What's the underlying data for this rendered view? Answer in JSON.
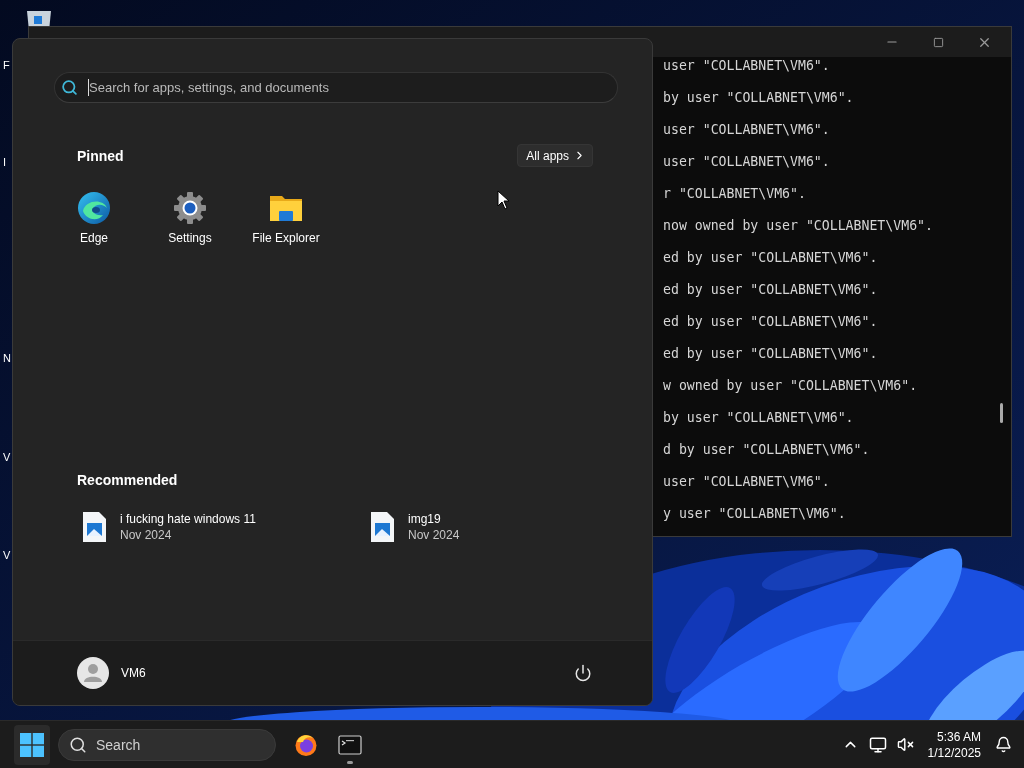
{
  "desktop": {
    "icon_labels": [
      "F",
      "I",
      "N",
      "V",
      "V"
    ]
  },
  "terminal": {
    "lines": [
      "user \"COLLABNET\\VM6\".",
      "by user \"COLLABNET\\VM6\".",
      "user \"COLLABNET\\VM6\".",
      "user \"COLLABNET\\VM6\".",
      "r \"COLLABNET\\VM6\".",
      "now owned by user \"COLLABNET\\VM6\".",
      "ed by user \"COLLABNET\\VM6\".",
      "ed by user \"COLLABNET\\VM6\".",
      "ed by user \"COLLABNET\\VM6\".",
      "ed by user \"COLLABNET\\VM6\".",
      "w owned by user \"COLLABNET\\VM6\".",
      "by user \"COLLABNET\\VM6\".",
      "d by user \"COLLABNET\\VM6\".",
      "user \"COLLABNET\\VM6\".",
      "y user \"COLLABNET\\VM6\"."
    ]
  },
  "start_menu": {
    "search": {
      "placeholder": "Search for apps, settings, and documents"
    },
    "pinned": {
      "title": "Pinned",
      "all_apps": "All apps",
      "apps": [
        {
          "label": "Edge",
          "kind": "edge"
        },
        {
          "label": "Settings",
          "kind": "settings"
        },
        {
          "label": "File Explorer",
          "kind": "folder"
        }
      ]
    },
    "recommended": {
      "title": "Recommended",
      "items": [
        {
          "name": "i fucking hate windows 11",
          "date": "Nov 2024"
        },
        {
          "name": "img19",
          "date": "Nov 2024"
        }
      ]
    },
    "user": {
      "name": "VM6"
    }
  },
  "taskbar": {
    "search": {
      "label": "Search"
    },
    "apps": [
      {
        "kind": "firefox",
        "running": false
      },
      {
        "kind": "terminal",
        "running": true
      }
    ],
    "clock": {
      "time": "5:36 AM",
      "date": "1/12/2025"
    }
  }
}
